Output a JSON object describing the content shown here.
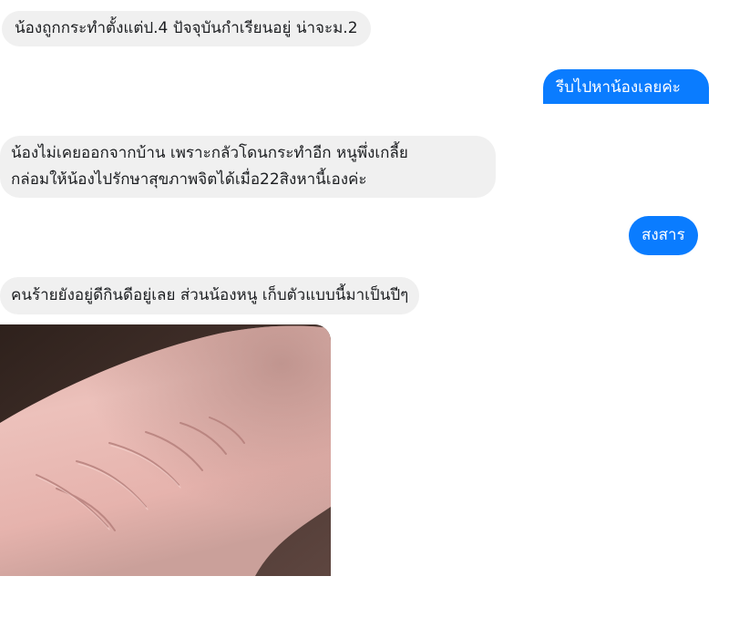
{
  "conversation": {
    "messages": [
      {
        "direction": "incoming",
        "text": "น้องถูกกระทำตั้งแต่ป.4 ปัจจุบันกำเรียนอยู่ น่าจะม.2"
      },
      {
        "direction": "outgoing",
        "text": "รีบไปหาน้องเลยค่ะ"
      },
      {
        "direction": "incoming",
        "lines": [
          "น้องไม่เคยออกจากบ้าน เพราะกลัวโดนกระทำอีก หนูพึ่งเกลี้ย",
          "กล่อมให้น้องไปรักษาสุขภาพจิตได้เมื่อ22สิงหานี้เองค่ะ"
        ]
      },
      {
        "direction": "outgoing",
        "text": "สงสาร"
      },
      {
        "direction": "incoming",
        "text": "คนร้ายยังอยู่ดีกินดีอยู่เลย ส่วนน้องหนู เก็บตัวแบบนี้มาเป็นปีๆ"
      }
    ],
    "attachment": {
      "type": "photo"
    }
  },
  "colors": {
    "outgoing_bubble": "#0a7cff",
    "incoming_bubble": "#f0f0f0",
    "background": "#ffffff"
  }
}
